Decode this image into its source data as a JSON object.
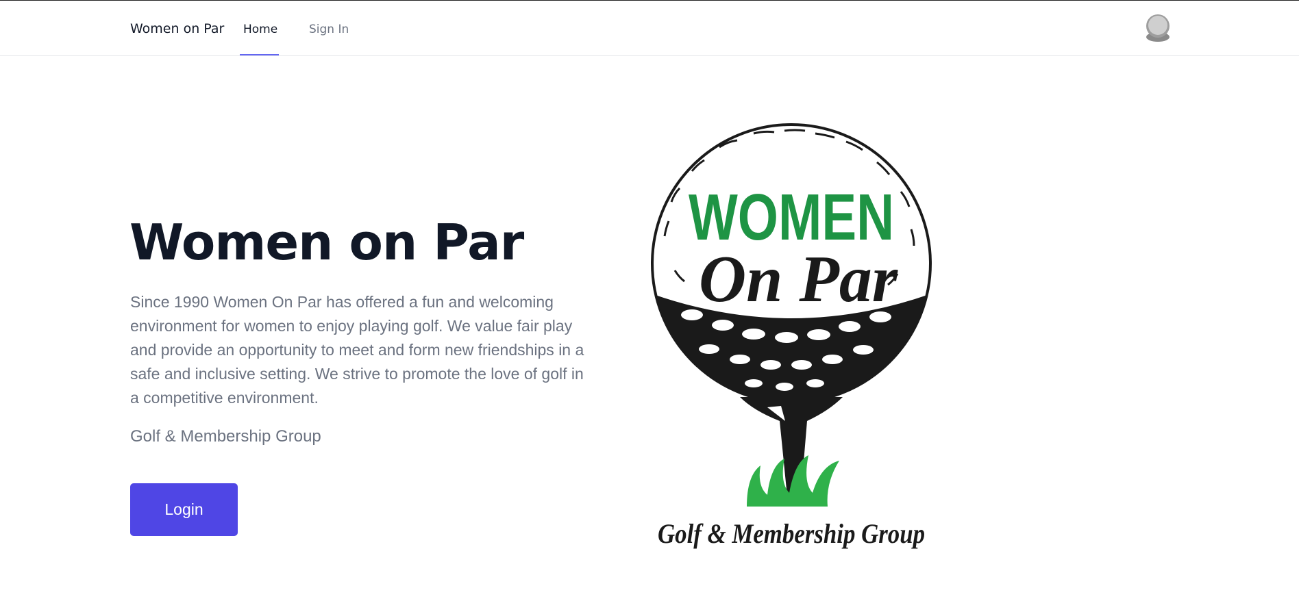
{
  "nav": {
    "brand": "Women on Par",
    "links": [
      {
        "label": "Home",
        "active": true
      },
      {
        "label": "Sign In",
        "active": false
      }
    ],
    "avatar_icon": "user-avatar-icon"
  },
  "hero": {
    "title": "Women on Par",
    "description": "Since 1990 Women On Par has offered a fun and welcoming environment for women to enjoy playing golf. We value fair play and provide an opportunity to meet and form new friendships in a safe and inclusive setting. We strive to promote the love of golf in a competitive environment.",
    "subtitle": "Golf & Membership Group",
    "login_label": "Login"
  },
  "logo": {
    "line1": "WOMEN",
    "line2": "On Par",
    "tagline": "Golf & Membership Group",
    "colors": {
      "green": "#1e9444",
      "black": "#1a1a1a",
      "grass": "#2fb14a"
    }
  },
  "colors": {
    "accent": "#4f46e5",
    "underline": "#6366f1",
    "text_dark": "#111827",
    "text_muted": "#6b7280"
  }
}
